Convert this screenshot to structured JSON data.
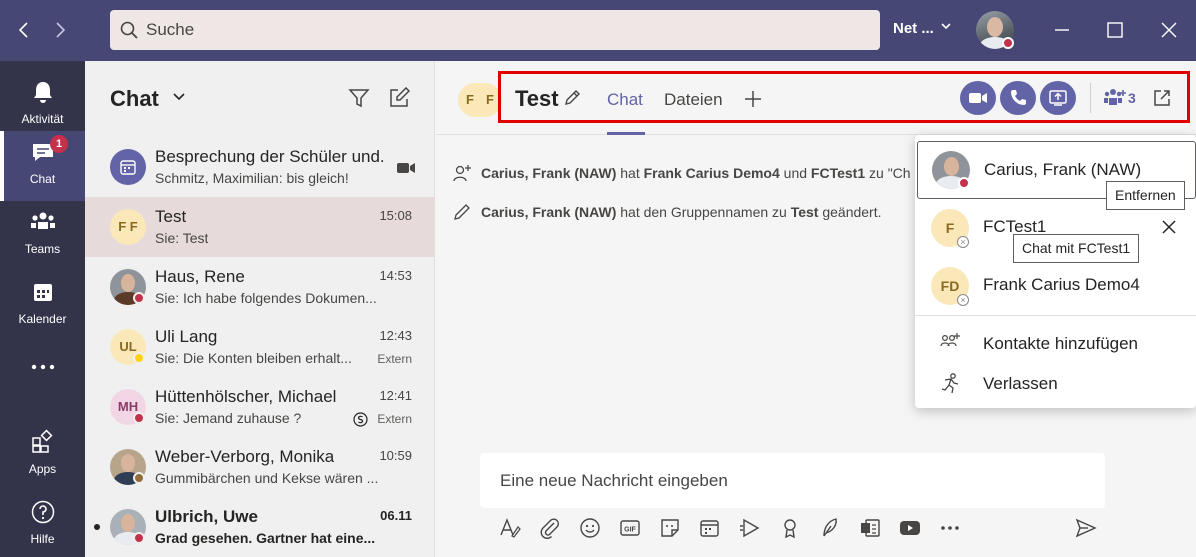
{
  "titlebar": {
    "search_placeholder": "Suche",
    "org_label": "Net ...",
    "back_icon": "chevron-left-icon",
    "forward_icon": "chevron-right-icon"
  },
  "rail": {
    "items": [
      {
        "label": "Aktivität",
        "icon": "bell-icon"
      },
      {
        "label": "Chat",
        "icon": "chat-icon",
        "badge": "1"
      },
      {
        "label": "Teams",
        "icon": "teams-icon"
      },
      {
        "label": "Kalender",
        "icon": "calendar-icon"
      },
      {
        "label": "Apps",
        "icon": "apps-icon"
      },
      {
        "label": "Hilfe",
        "icon": "help-icon"
      }
    ]
  },
  "chatlist": {
    "title": "Chat",
    "rows": [
      {
        "name": "Besprechung der Schüler und...",
        "preview": "Schmitz, Maximilian: bis gleich!",
        "time": "",
        "extern": ""
      },
      {
        "name": "Test",
        "preview": "Sie: Test",
        "time": "15:08",
        "extern": "",
        "initials": "F F"
      },
      {
        "name": "Haus, Rene",
        "preview": "Sie: Ich habe folgendes Dokumen...",
        "time": "14:53",
        "extern": ""
      },
      {
        "name": "Uli Lang",
        "preview": "Sie: Die Konten bleiben erhalt...",
        "time": "12:43",
        "extern": "Extern",
        "initials": "UL"
      },
      {
        "name": "Hüttenhölscher, Michael",
        "preview": "Sie: Jemand zuhause ?",
        "time": "12:41",
        "extern": "Extern",
        "initials": "MH"
      },
      {
        "name": "Weber-Verborg, Monika",
        "preview": "Gummibärchen und Kekse wären ...",
        "time": "10:59",
        "extern": ""
      },
      {
        "name": "Ulbrich, Uwe",
        "preview": "Grad gesehen. Gartner hat eine...",
        "time": "06.11",
        "extern": ""
      }
    ]
  },
  "header": {
    "group_initials": [
      "F",
      "F"
    ],
    "title": "Test",
    "tabs": [
      "Chat",
      "Dateien"
    ],
    "people_count": "3"
  },
  "messages": [
    {
      "parts": [
        {
          "text": "Carius, Frank (NAW)",
          "bold": true
        },
        {
          "text": " hat ",
          "bold": false
        },
        {
          "text": "Frank Carius Demo4",
          "bold": true
        },
        {
          "text": " und ",
          "bold": false
        },
        {
          "text": "FCTest1",
          "bold": true
        },
        {
          "text": " zu \"Ch",
          "bold": false
        }
      ]
    },
    {
      "parts": [
        {
          "text": "Carius, Frank (NAW)",
          "bold": true
        },
        {
          "text": " hat den Gruppennamen zu ",
          "bold": false
        },
        {
          "text": "Test",
          "bold": true
        },
        {
          "text": " geändert.",
          "bold": false
        }
      ]
    }
  ],
  "composer": {
    "placeholder": "Eine neue Nachricht eingeben"
  },
  "participants": {
    "people": [
      {
        "name": "Carius, Frank (NAW)",
        "initials": ""
      },
      {
        "name": "FCTest1",
        "initials": "F"
      },
      {
        "name": "Frank Carius Demo4",
        "initials": "FD"
      }
    ],
    "actions": [
      "Kontakte hinzufügen",
      "Verlassen"
    ],
    "tooltip_remove": "Entfernen",
    "tooltip_chat": "Chat mit FCTest1"
  },
  "colors": {
    "titlebar": "#464775",
    "rail": "#33344a",
    "accent": "#6264a7",
    "badge": "#c4314b",
    "highlight": "#e00000"
  }
}
